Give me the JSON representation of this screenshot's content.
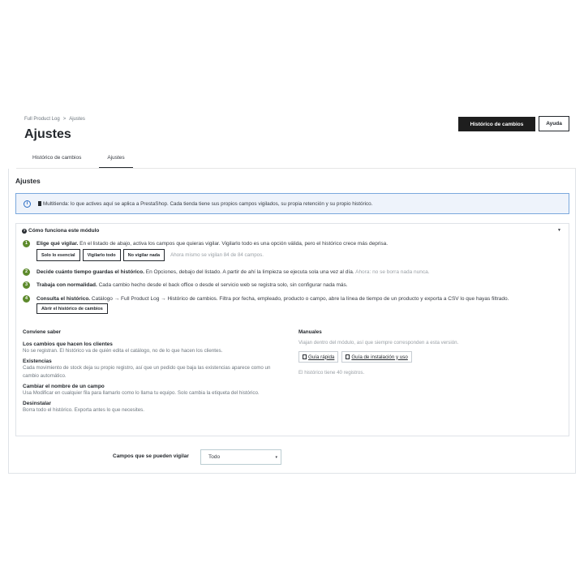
{
  "breadcrumb": {
    "parent": "Full Product Log",
    "separator": ">",
    "current": "Ajustes"
  },
  "page_title": "Ajustes",
  "header_buttons": {
    "history": "Histórico de cambios",
    "help": "Ayuda"
  },
  "tabs": [
    {
      "label": "Histórico de cambios"
    },
    {
      "label": "Ajustes"
    }
  ],
  "panel": {
    "title": "Ajustes",
    "alert": {
      "lead": "Multitienda:",
      "text": "lo que actives aquí se aplica a PrestaShop. Cada tienda tiene sus propios campos vigilados, su propia retención y su propio histórico."
    },
    "howto": {
      "title": "Cómo funciona este módulo",
      "steps": [
        {
          "num": "1",
          "bold": "Elige qué vigilar.",
          "text": "En el listado de abajo, activa los campos que quieras vigilar. Vigilarlo todo es una opción válida, pero el histórico crece más deprisa.",
          "buttons": [
            "Solo lo esencial",
            "Vigilarlo todo",
            "No vigilar nada"
          ],
          "note": "Ahora mismo se vigilan 84 de 84 campos."
        },
        {
          "num": "2",
          "bold": "Decide cuánto tiempo guardas el histórico.",
          "text": "En Opciones, debajo del listado. A partir de ahí la limpieza se ejecuta sola una vez al día.",
          "note": "Ahora: no se borra nada nunca."
        },
        {
          "num": "3",
          "bold": "Trabaja con normalidad.",
          "text": "Cada cambio hecho desde el back office o desde el servicio web se registra solo, sin configurar nada más."
        },
        {
          "num": "4",
          "bold": "Consulta el histórico.",
          "text": "Catálogo → Full Product Log → Histórico de cambios. Filtra por fecha, empleado, producto o campo, abre la línea de tiempo de un producto y exporta a CSV lo que hayas filtrado.",
          "button": "Abrir el histórico de cambios"
        }
      ]
    },
    "know": {
      "title": "Conviene saber",
      "items": [
        {
          "title": "Los cambios que hacen los clientes",
          "desc": "No se registran. El histórico va de quién edita el catálogo, no de lo que hacen los clientes."
        },
        {
          "title": "Existencias",
          "desc": "Cada movimiento de stock deja su propio registro, así que un pedido que baja las existencias aparece como un cambio automático."
        },
        {
          "title": "Cambiar el nombre de un campo",
          "desc": "Usa Modificar en cualquier fila para llamarlo como lo llama tu equipo. Solo cambia la etiqueta del histórico."
        },
        {
          "title": "Desinstalar",
          "desc": "Borra todo el histórico. Exporta antes lo que necesites."
        }
      ]
    },
    "manuals": {
      "title": "Manuales",
      "subtitle": "Viajan dentro del módulo, así que siempre corresponden a esta versión.",
      "buttons": [
        "Guía rápida",
        "Guía de instalación y uso"
      ],
      "count": "El histórico tiene 40 registros."
    },
    "fields": {
      "label": "Campos que se pueden vigilar",
      "selected": "Todo"
    }
  }
}
